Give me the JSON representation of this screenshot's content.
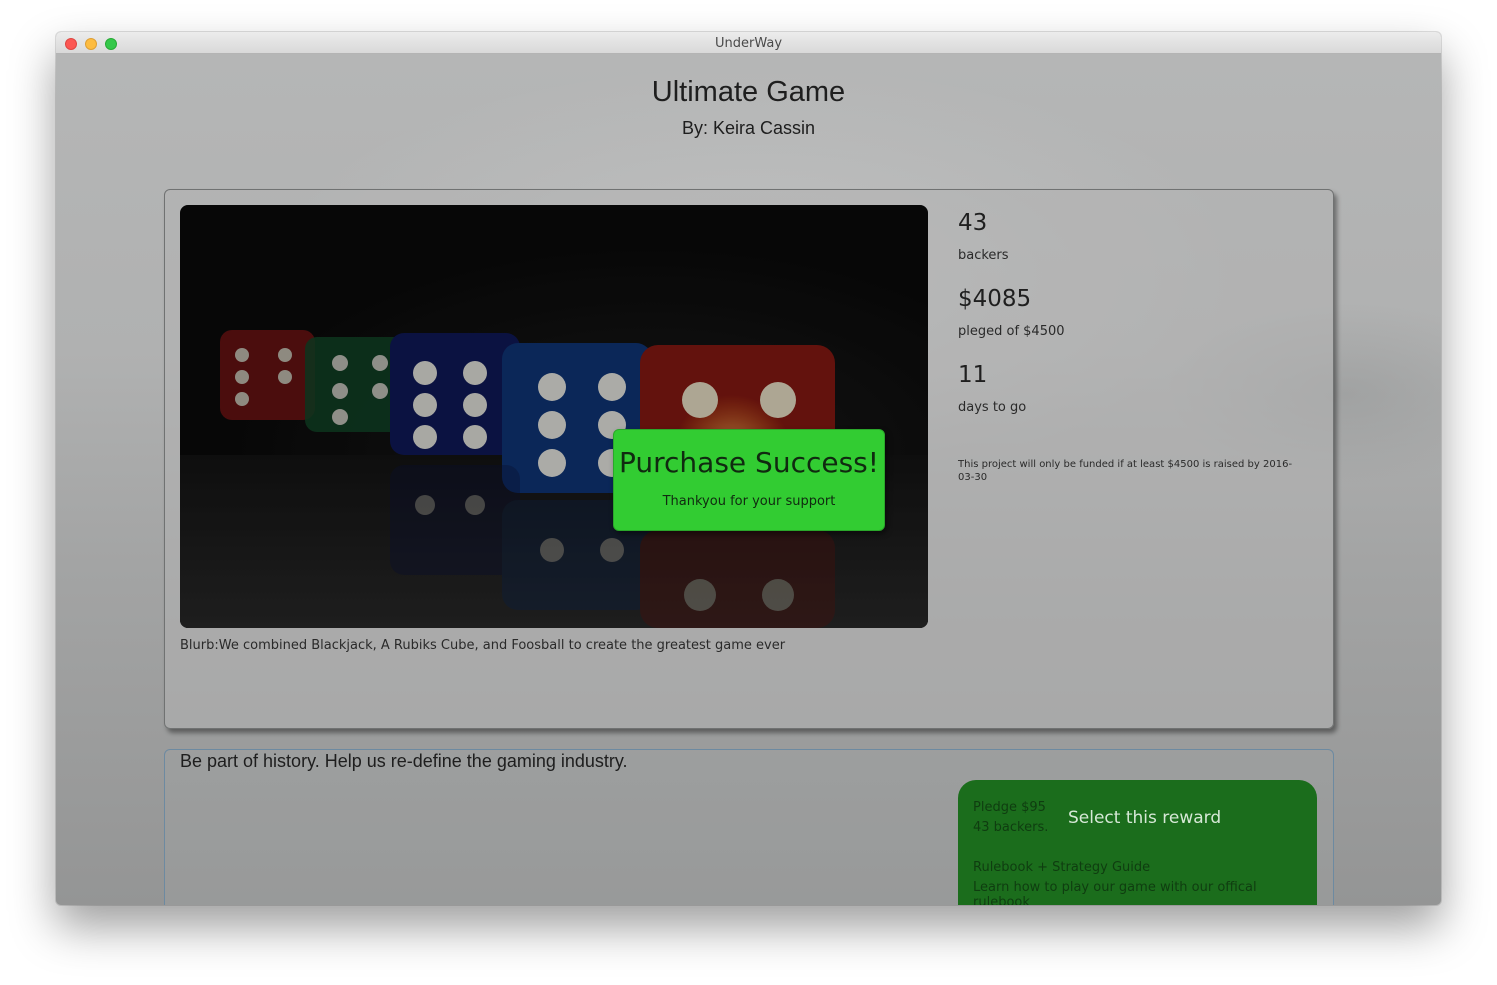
{
  "window": {
    "title": "UnderWay"
  },
  "project": {
    "title": "Ultimate Game",
    "author": "By: Keira Cassin",
    "blurb": "Blurb:We combined Blackjack, A Rubiks Cube, and Foosball to create the greatest game ever",
    "tagline": "Be part of history. Help us re-define the gaming industry."
  },
  "stats": {
    "backers_count": "43",
    "backers_label": "backers",
    "pledged_amount": "$4085",
    "pledged_label": "pleged of $4500",
    "days_count": "11",
    "days_label": "days to go",
    "funding_note": "This project will only be funded if at least $4500 is raised by 2016-03-30"
  },
  "modal": {
    "title": "Purchase Success!",
    "subtitle": "Thankyou for your support",
    "color": "#32cc32"
  },
  "reward": {
    "pledge": "Pledge $95",
    "backers": "43 backers.",
    "button_label": "Select this reward",
    "name": "Rulebook + Strategy Guide",
    "description": "Learn how to play our game with our offical rulebook",
    "color": "#1b6d1c"
  },
  "icons": {
    "close": "close-window-icon",
    "minimize": "minimize-window-icon",
    "maximize": "maximize-window-icon"
  }
}
